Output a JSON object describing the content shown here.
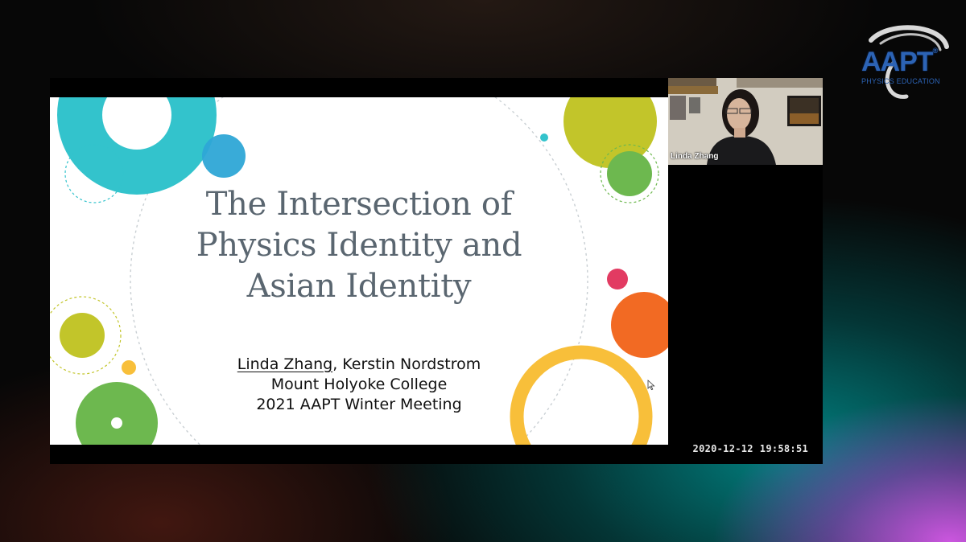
{
  "logo": {
    "name": "AAPT",
    "tagline": "PHYSICS EDUCATION",
    "registered": "®"
  },
  "slide": {
    "title_lines": [
      "The Intersection of",
      "Physics Identity and",
      "Asian Identity"
    ],
    "presenter": "Linda Zhang",
    "coauthor": ", Kerstin Nordstrom",
    "institution": "Mount Holyoke College",
    "event": "2021 AAPT Winter Meeting"
  },
  "participant": {
    "name": "Linda Zhang"
  },
  "recording": {
    "date": "2020-12-12",
    "time": "19:58:51"
  },
  "colors": {
    "teal": "#33c3cc",
    "blue": "#2ea6d6",
    "lime": "#c2c52a",
    "green": "#6db84f",
    "pink": "#e23b62",
    "orange": "#f26a23",
    "yellow": "#f8bf3a",
    "logo_blue": "#2c63b5"
  }
}
